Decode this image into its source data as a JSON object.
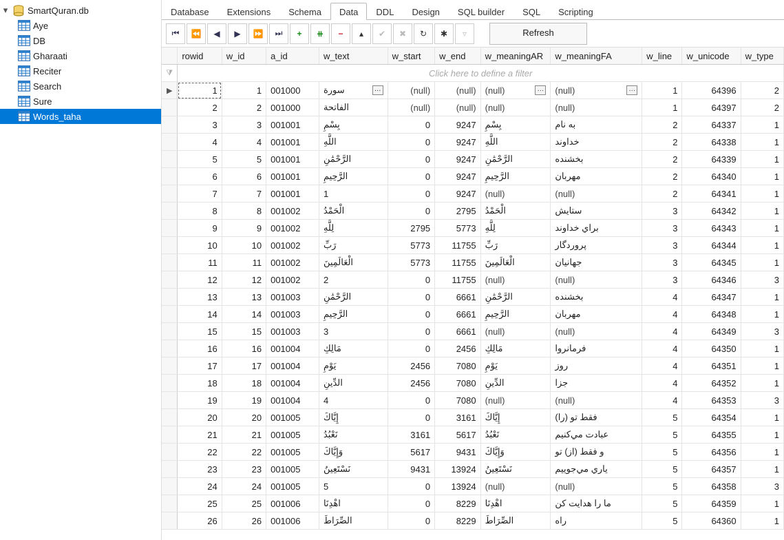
{
  "sidebar": {
    "db_name": "SmartQuran.db",
    "tables": [
      "Aye",
      "DB",
      "Gharaati",
      "Reciter",
      "Search",
      "Sure",
      "Words_taha"
    ],
    "selected_index": 6
  },
  "tabs": [
    "Database",
    "Extensions",
    "Schema",
    "Data",
    "DDL",
    "Design",
    "SQL builder",
    "SQL",
    "Scripting"
  ],
  "active_tab_index": 3,
  "toolbar": {
    "refresh_label": "Refresh"
  },
  "grid": {
    "filter_placeholder": "Click here to define a filter",
    "columns": [
      "rowid",
      "w_id",
      "a_id",
      "w_text",
      "w_start",
      "w_end",
      "w_meaningAR",
      "w_meaningFA",
      "w_line",
      "w_unicode",
      "w_type"
    ],
    "rows": [
      {
        "rowid": 1,
        "w_id": 1,
        "a_id": "001000",
        "w_text": "سورة",
        "w_start": "(null)",
        "w_end": "(null)",
        "w_meaningAR": "(null)",
        "w_meaningFA": "(null)",
        "w_line": 1,
        "w_unicode": 64396,
        "w_type": 2
      },
      {
        "rowid": 2,
        "w_id": 2,
        "a_id": "001000",
        "w_text": "الفاتحة",
        "w_start": "(null)",
        "w_end": "(null)",
        "w_meaningAR": "(null)",
        "w_meaningFA": "(null)",
        "w_line": 1,
        "w_unicode": 64397,
        "w_type": 2
      },
      {
        "rowid": 3,
        "w_id": 3,
        "a_id": "001001",
        "w_text": "بِسْمِ",
        "w_start": 0,
        "w_end": 9247,
        "w_meaningAR": "بِسْمِ",
        "w_meaningFA": "به نام",
        "w_line": 2,
        "w_unicode": 64337,
        "w_type": 1
      },
      {
        "rowid": 4,
        "w_id": 4,
        "a_id": "001001",
        "w_text": "اللَّهِ",
        "w_start": 0,
        "w_end": 9247,
        "w_meaningAR": "اللَّهِ",
        "w_meaningFA": "خداوند",
        "w_line": 2,
        "w_unicode": 64338,
        "w_type": 1
      },
      {
        "rowid": 5,
        "w_id": 5,
        "a_id": "001001",
        "w_text": "الرَّحْمَٰنِ",
        "w_start": 0,
        "w_end": 9247,
        "w_meaningAR": "الرَّحْمَٰنِ",
        "w_meaningFA": "بخشنده",
        "w_line": 2,
        "w_unicode": 64339,
        "w_type": 1
      },
      {
        "rowid": 6,
        "w_id": 6,
        "a_id": "001001",
        "w_text": "الرَّحِيمِ",
        "w_start": 0,
        "w_end": 9247,
        "w_meaningAR": "الرَّحِيمِ",
        "w_meaningFA": "مهربان",
        "w_line": 2,
        "w_unicode": 64340,
        "w_type": 1
      },
      {
        "rowid": 7,
        "w_id": 7,
        "a_id": "001001",
        "w_text": "1",
        "w_start": 0,
        "w_end": 9247,
        "w_meaningAR": "(null)",
        "w_meaningFA": "(null)",
        "w_line": 2,
        "w_unicode": 64341,
        "w_type": 1
      },
      {
        "rowid": 8,
        "w_id": 8,
        "a_id": "001002",
        "w_text": "الْحَمْدُ",
        "w_start": 0,
        "w_end": 2795,
        "w_meaningAR": "الْحَمْدُ",
        "w_meaningFA": "ستايش",
        "w_line": 3,
        "w_unicode": 64342,
        "w_type": 1
      },
      {
        "rowid": 9,
        "w_id": 9,
        "a_id": "001002",
        "w_text": "لِلَّهِ",
        "w_start": 2795,
        "w_end": 5773,
        "w_meaningAR": "لِلَّهِ",
        "w_meaningFA": "براي خداوند",
        "w_line": 3,
        "w_unicode": 64343,
        "w_type": 1
      },
      {
        "rowid": 10,
        "w_id": 10,
        "a_id": "001002",
        "w_text": "رَبِّ",
        "w_start": 5773,
        "w_end": 11755,
        "w_meaningAR": "رَبِّ",
        "w_meaningFA": "پروردگار",
        "w_line": 3,
        "w_unicode": 64344,
        "w_type": 1
      },
      {
        "rowid": 11,
        "w_id": 11,
        "a_id": "001002",
        "w_text": "الْعَالَمِينَ",
        "w_start": 5773,
        "w_end": 11755,
        "w_meaningAR": "الْعَالَمِينَ",
        "w_meaningFA": "جهانيان",
        "w_line": 3,
        "w_unicode": 64345,
        "w_type": 1
      },
      {
        "rowid": 12,
        "w_id": 12,
        "a_id": "001002",
        "w_text": "2",
        "w_start": 0,
        "w_end": 11755,
        "w_meaningAR": "(null)",
        "w_meaningFA": "(null)",
        "w_line": 3,
        "w_unicode": 64346,
        "w_type": 3
      },
      {
        "rowid": 13,
        "w_id": 13,
        "a_id": "001003",
        "w_text": "الرَّحْمَٰنِ",
        "w_start": 0,
        "w_end": 6661,
        "w_meaningAR": "الرَّحْمَٰنِ",
        "w_meaningFA": "بخشنده",
        "w_line": 4,
        "w_unicode": 64347,
        "w_type": 1
      },
      {
        "rowid": 14,
        "w_id": 14,
        "a_id": "001003",
        "w_text": "الرَّحِيمِ",
        "w_start": 0,
        "w_end": 6661,
        "w_meaningAR": "الرَّحِيمِ",
        "w_meaningFA": "مهربان",
        "w_line": 4,
        "w_unicode": 64348,
        "w_type": 1
      },
      {
        "rowid": 15,
        "w_id": 15,
        "a_id": "001003",
        "w_text": "3",
        "w_start": 0,
        "w_end": 6661,
        "w_meaningAR": "(null)",
        "w_meaningFA": "(null)",
        "w_line": 4,
        "w_unicode": 64349,
        "w_type": 3
      },
      {
        "rowid": 16,
        "w_id": 16,
        "a_id": "001004",
        "w_text": "مَالِكِ",
        "w_start": 0,
        "w_end": 2456,
        "w_meaningAR": "مَالِكِ",
        "w_meaningFA": "فرمانروا",
        "w_line": 4,
        "w_unicode": 64350,
        "w_type": 1
      },
      {
        "rowid": 17,
        "w_id": 17,
        "a_id": "001004",
        "w_text": "يَوْمِ",
        "w_start": 2456,
        "w_end": 7080,
        "w_meaningAR": "يَوْمِ",
        "w_meaningFA": "روز",
        "w_line": 4,
        "w_unicode": 64351,
        "w_type": 1
      },
      {
        "rowid": 18,
        "w_id": 18,
        "a_id": "001004",
        "w_text": "الدِّينِ",
        "w_start": 2456,
        "w_end": 7080,
        "w_meaningAR": "الدِّينِ",
        "w_meaningFA": "جزا",
        "w_line": 4,
        "w_unicode": 64352,
        "w_type": 1
      },
      {
        "rowid": 19,
        "w_id": 19,
        "a_id": "001004",
        "w_text": "4",
        "w_start": 0,
        "w_end": 7080,
        "w_meaningAR": "(null)",
        "w_meaningFA": "(null)",
        "w_line": 4,
        "w_unicode": 64353,
        "w_type": 3
      },
      {
        "rowid": 20,
        "w_id": 20,
        "a_id": "001005",
        "w_text": "إِيَّاكَ",
        "w_start": 0,
        "w_end": 3161,
        "w_meaningAR": "إِيَّاكَ",
        "w_meaningFA": "فقط تو (را)",
        "w_line": 5,
        "w_unicode": 64354,
        "w_type": 1
      },
      {
        "rowid": 21,
        "w_id": 21,
        "a_id": "001005",
        "w_text": "نَعْبُدُ",
        "w_start": 3161,
        "w_end": 5617,
        "w_meaningAR": "نَعْبُدُ",
        "w_meaningFA": "عبادت مي‌كنيم",
        "w_line": 5,
        "w_unicode": 64355,
        "w_type": 1
      },
      {
        "rowid": 22,
        "w_id": 22,
        "a_id": "001005",
        "w_text": "وَإِيَّاكَ",
        "w_start": 5617,
        "w_end": 9431,
        "w_meaningAR": "وَإِيَّاكَ",
        "w_meaningFA": "و فقط (از) تو",
        "w_line": 5,
        "w_unicode": 64356,
        "w_type": 1
      },
      {
        "rowid": 23,
        "w_id": 23,
        "a_id": "001005",
        "w_text": "نَسْتَعِينُ",
        "w_start": 9431,
        "w_end": 13924,
        "w_meaningAR": "نَسْتَعِينُ",
        "w_meaningFA": "ياري مي‌جوييم",
        "w_line": 5,
        "w_unicode": 64357,
        "w_type": 1
      },
      {
        "rowid": 24,
        "w_id": 24,
        "a_id": "001005",
        "w_text": "5",
        "w_start": 0,
        "w_end": 13924,
        "w_meaningAR": "(null)",
        "w_meaningFA": "(null)",
        "w_line": 5,
        "w_unicode": 64358,
        "w_type": 3
      },
      {
        "rowid": 25,
        "w_id": 25,
        "a_id": "001006",
        "w_text": "اهْدِنَا",
        "w_start": 0,
        "w_end": 8229,
        "w_meaningAR": "اهْدِنَا",
        "w_meaningFA": "ما را هدايت كن",
        "w_line": 5,
        "w_unicode": 64359,
        "w_type": 1
      },
      {
        "rowid": 26,
        "w_id": 26,
        "a_id": "001006",
        "w_text": "الصِّرَاطَ",
        "w_start": 0,
        "w_end": 8229,
        "w_meaningAR": "الصِّرَاطَ",
        "w_meaningFA": "راه",
        "w_line": 5,
        "w_unicode": 64360,
        "w_type": 1
      }
    ]
  }
}
